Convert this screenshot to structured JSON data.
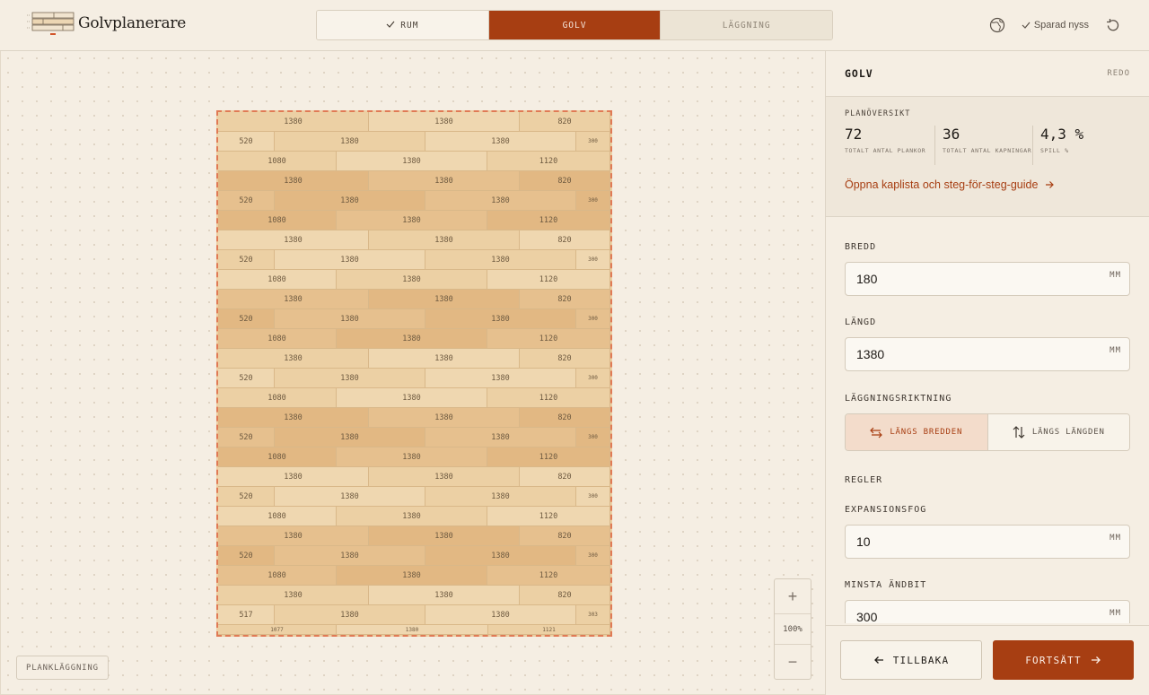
{
  "app": {
    "title": "Golvplanerare"
  },
  "steps": [
    {
      "label": "RUM",
      "state": "done"
    },
    {
      "label": "GOLV",
      "state": "active"
    },
    {
      "label": "LÄGGNING",
      "state": "todo"
    }
  ],
  "header": {
    "saved_status": "Sparad nyss",
    "globe_icon": "globe-icon",
    "reset_icon": "reset-icon"
  },
  "canvas": {
    "mode_label": "PLANKLÄGGNING",
    "zoom_level": "100%",
    "zoom_in": "+",
    "zoom_out": "−"
  },
  "floor_rows": [
    [
      "1380",
      "1380",
      "820"
    ],
    [
      "520",
      "1380",
      "1380",
      "300"
    ],
    [
      "1080",
      "1380",
      "1120"
    ],
    [
      "1380",
      "1380",
      "820"
    ],
    [
      "520",
      "1380",
      "1380",
      "300"
    ],
    [
      "1080",
      "1380",
      "1120"
    ],
    [
      "1380",
      "1380",
      "820"
    ],
    [
      "520",
      "1380",
      "1380",
      "300"
    ],
    [
      "1080",
      "1380",
      "1120"
    ],
    [
      "1380",
      "1380",
      "820"
    ],
    [
      "520",
      "1380",
      "1380",
      "300"
    ],
    [
      "1080",
      "1380",
      "1120"
    ],
    [
      "1380",
      "1380",
      "820"
    ],
    [
      "520",
      "1380",
      "1380",
      "300"
    ],
    [
      "1080",
      "1380",
      "1120"
    ],
    [
      "1380",
      "1380",
      "820"
    ],
    [
      "520",
      "1380",
      "1380",
      "300"
    ],
    [
      "1080",
      "1380",
      "1120"
    ],
    [
      "1380",
      "1380",
      "820"
    ],
    [
      "520",
      "1380",
      "1380",
      "300"
    ],
    [
      "1080",
      "1380",
      "1120"
    ],
    [
      "1380",
      "1380",
      "820"
    ],
    [
      "520",
      "1380",
      "1380",
      "300"
    ],
    [
      "1080",
      "1380",
      "1120"
    ],
    [
      "1380",
      "1380",
      "820"
    ],
    [
      "517",
      "1380",
      "1380",
      "303"
    ],
    [
      "1077",
      "1380",
      "1121"
    ]
  ],
  "panel": {
    "title": "GOLV",
    "status": "REDO",
    "overview": {
      "label": "PLANÖVERSIKT",
      "stats": [
        {
          "value": "72",
          "caption": "TOTALT ANTAL PLANKOR"
        },
        {
          "value": "36",
          "caption": "TOTALT ANTAL KAPNINGAR"
        },
        {
          "value": "4,3 %",
          "caption": "SPILL %"
        }
      ],
      "link": "Öppna kaplista och steg-för-steg-guide"
    },
    "fields": {
      "width": {
        "label": "BREDD",
        "value": "180",
        "unit": "MM"
      },
      "length": {
        "label": "LÄNGD",
        "value": "1380",
        "unit": "MM"
      },
      "direction": {
        "label": "LÄGGNINGSRIKTNING",
        "options": [
          "LÄNGS BREDDEN",
          "LÄNGS LÄNGDEN"
        ],
        "selected": "LÄNGS BREDDEN"
      },
      "rules_label": "REGLER",
      "expansion": {
        "label": "EXPANSIONSFOG",
        "value": "10",
        "unit": "MM"
      },
      "min_end": {
        "label": "MINSTA ÄNDBIT",
        "value": "300",
        "unit": "MM"
      }
    },
    "buttons": {
      "back": "TILLBAKA",
      "next": "FORTSÄTT"
    }
  }
}
